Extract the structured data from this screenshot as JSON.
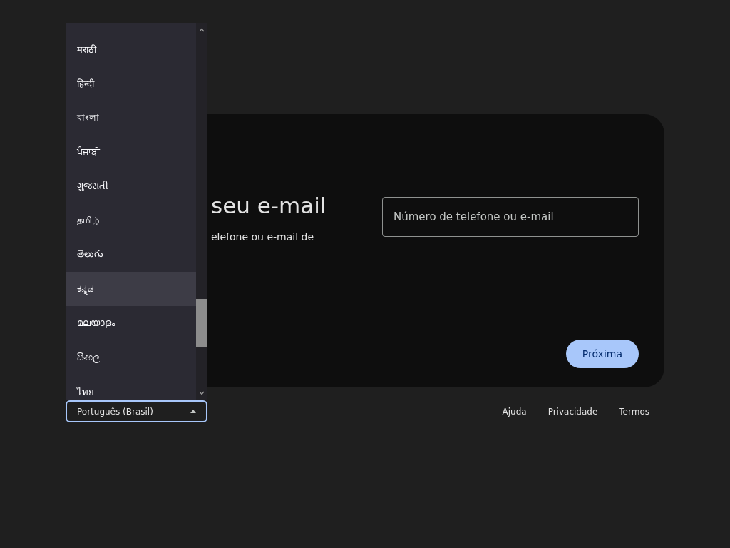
{
  "card": {
    "heading": "seu e-mail",
    "description": "elefone ou e-mail de",
    "email_field": {
      "placeholder": "Número de telefone ou e-mail"
    },
    "next_button": "Próxima"
  },
  "language_select": {
    "value": "Português (Brasil)",
    "expanded": true
  },
  "language_menu": [
    {
      "label": "मराठी",
      "highlighted": false
    },
    {
      "label": "हिन्दी",
      "highlighted": false
    },
    {
      "label": "বাংলা",
      "highlighted": false
    },
    {
      "label": "ਪੰਜਾਬੀ",
      "highlighted": false
    },
    {
      "label": "ગુજરાતી",
      "highlighted": false
    },
    {
      "label": "தமிழ்",
      "highlighted": false
    },
    {
      "label": "తెలుగు",
      "highlighted": false
    },
    {
      "label": "ಕನ್ನಡ",
      "highlighted": true
    },
    {
      "label": "മലയാളം",
      "highlighted": false
    },
    {
      "label": "සිංහල",
      "highlighted": false
    },
    {
      "label": "ไทย",
      "highlighted": false
    }
  ],
  "footer_links": [
    "Ajuda",
    "Privacidade",
    "Termos"
  ]
}
